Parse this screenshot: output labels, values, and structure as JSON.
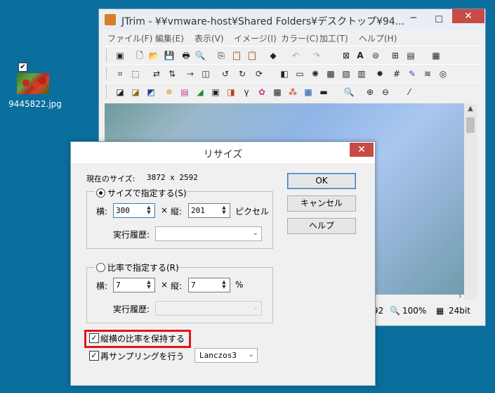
{
  "desktop": {
    "icon_label": "9445822.jpg"
  },
  "window": {
    "title": "JTrim - ¥¥vmware-host¥Shared Folders¥デスクトップ¥94...",
    "minimize": "─",
    "maximize": "☐",
    "close": "✕",
    "menu": [
      "ファイル(F)",
      "編集(E)",
      "表示(V)",
      "イメージ(I)",
      "カラー(C)",
      "加工(T)",
      "ヘルプ(H)"
    ],
    "status": {
      "partial": "92",
      "zoom": "100%",
      "depth": "24bit"
    }
  },
  "dialog": {
    "title": "リサイズ",
    "close": "✕",
    "current_size_label": "現在のサイズ:",
    "current_size_value": "3872 x 2592",
    "by_size": {
      "label": "サイズで指定する(S)",
      "width_label": "横:",
      "width_value": "300",
      "times": "×",
      "height_label": "縦:",
      "height_value": "201",
      "unit": "ピクセル",
      "history_label": "実行履歴:"
    },
    "by_ratio": {
      "label": "比率で指定する(R)",
      "width_label": "横:",
      "width_value": "7",
      "times": "×",
      "height_label": "縦:",
      "height_value": "7",
      "unit": "%",
      "history_label": "実行履歴:"
    },
    "keep_ratio_label": "縦横の比率を保持する",
    "resample_label": "再サンプリングを行う",
    "resample_method": "Lanczos3",
    "buttons": {
      "ok": "OK",
      "cancel": "キャンセル",
      "help": "ヘルプ"
    }
  }
}
